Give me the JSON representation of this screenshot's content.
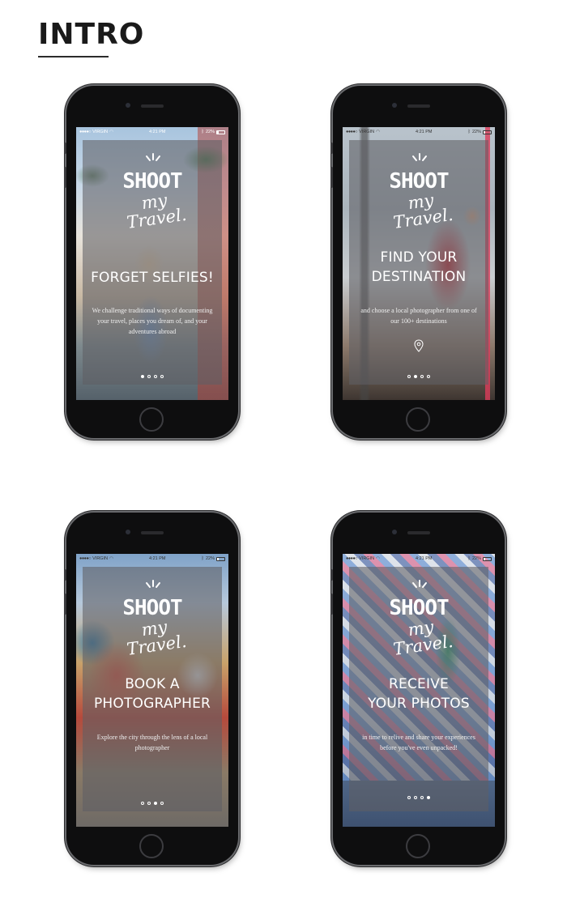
{
  "page": {
    "title": "INTRO"
  },
  "status": {
    "carrier": "VIRGIN",
    "time": "4:21 PM",
    "battery": "22%",
    "signal": "●●●●○"
  },
  "logo": {
    "brand": "SHOOT",
    "tagline": "my Travel."
  },
  "screens": [
    {
      "headline_line1": "FORGET SELFIES!",
      "headline_line2": "",
      "body": "We challenge traditional ways of documenting your travel, places you dream of, and your adventures abroad",
      "active_page": 1,
      "show_pin": false,
      "palette": "beach"
    },
    {
      "headline_line1": "FIND YOUR",
      "headline_line2": "DESTINATION",
      "body": "and choose a local photographer from one of our 100+ destinations",
      "active_page": 2,
      "show_pin": true,
      "icon": "location-pin-icon",
      "palette": "paris"
    },
    {
      "headline_line1": "BOOK A",
      "headline_line2": "PHOTOGRAPHER",
      "body": "Explore the city through the lens of a local photographer",
      "active_page": 3,
      "show_pin": false,
      "palette": "mural"
    },
    {
      "headline_line1": "RECEIVE",
      "headline_line2": "YOUR PHOTOS",
      "body": "in time to relive and share your experiences before you've even unpacked!",
      "active_page": 4,
      "show_pin": false,
      "palette": "pattern"
    }
  ],
  "page_count": 4
}
